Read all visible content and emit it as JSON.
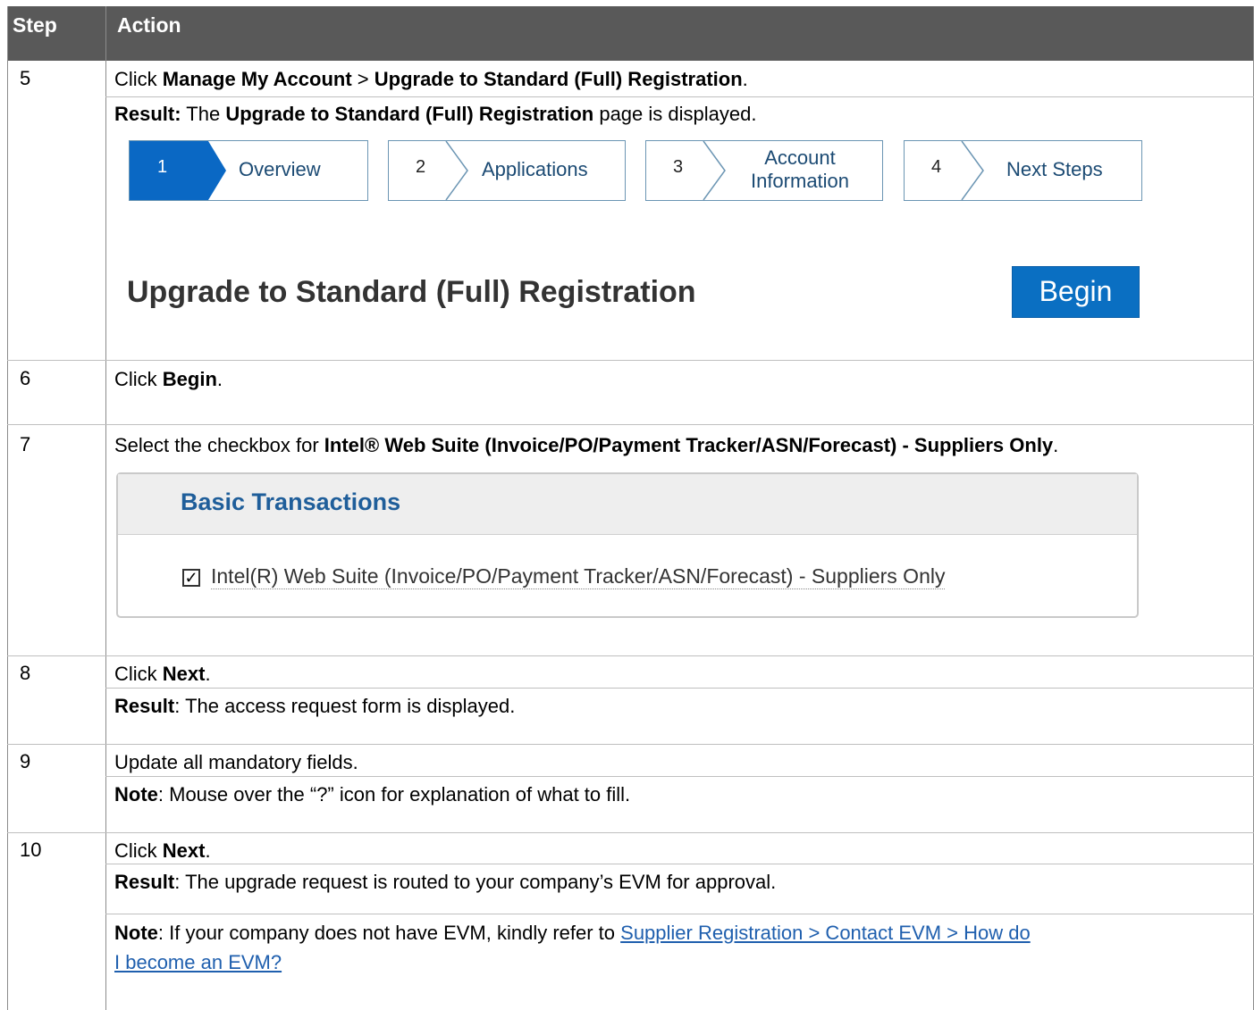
{
  "header": {
    "step": "Step",
    "action": "Action"
  },
  "rows": {
    "r5": {
      "num": "5",
      "l1": {
        "pre": "Click ",
        "b1": "Manage My Account",
        "mid": " > ",
        "b2": "Upgrade to Standard (Full) Registration",
        "post": "."
      },
      "l2": {
        "b1": "Result:",
        "mid": " The ",
        "b2": "Upgrade to Standard (Full) Registration",
        "post": " page is displayed."
      }
    },
    "r6": {
      "num": "6",
      "pre": "Click ",
      "b": "Begin",
      "post": "."
    },
    "r7": {
      "num": "7",
      "pre": "Select the checkbox for ",
      "b": "Intel® Web Suite (Invoice/PO/Payment Tracker/ASN/Forecast) - Suppliers Only",
      "post": "."
    },
    "r8": {
      "num": "8",
      "l1": {
        "pre": "Click ",
        "b": "Next",
        "post": "."
      },
      "l2": {
        "b": "Result",
        "post": ": The access request form is displayed."
      }
    },
    "r9": {
      "num": "9",
      "l1": "Update all mandatory fields.",
      "l2": {
        "b": "Note",
        "post": ": Mouse over the “?” icon for explanation of what to fill."
      }
    },
    "r10": {
      "num": "10",
      "l1": {
        "pre": "Click ",
        "b": "Next",
        "post": "."
      },
      "l2": {
        "b": "Result",
        "post": ": The upgrade request is routed to your company’s EVM for approval."
      },
      "l3": {
        "b": "Note",
        "post": ": If your company does not have EVM, kindly refer to ",
        "link1": "Supplier Registration > Contact EVM > How do",
        "link2": "I become an EVM?"
      }
    }
  },
  "screenshot1": {
    "steps": [
      {
        "num": "1",
        "label": "Overview"
      },
      {
        "num": "2",
        "label": "Applications"
      },
      {
        "num": "3",
        "label1": "Account",
        "label2": "Information"
      },
      {
        "num": "4",
        "label": "Next Steps"
      }
    ],
    "title": "Upgrade to Standard (Full) Registration",
    "begin": "Begin"
  },
  "screenshot2": {
    "panel_title": "Basic Transactions",
    "checkbox_label": "Intel(R) Web Suite (Invoice/PO/Payment Tracker/ASN/Forecast) - Suppliers Only",
    "checked_mark": "✓"
  },
  "colors": {
    "header_bg": "#595959",
    "accent_blue": "#0a68c4",
    "link": "#1f5fae"
  }
}
